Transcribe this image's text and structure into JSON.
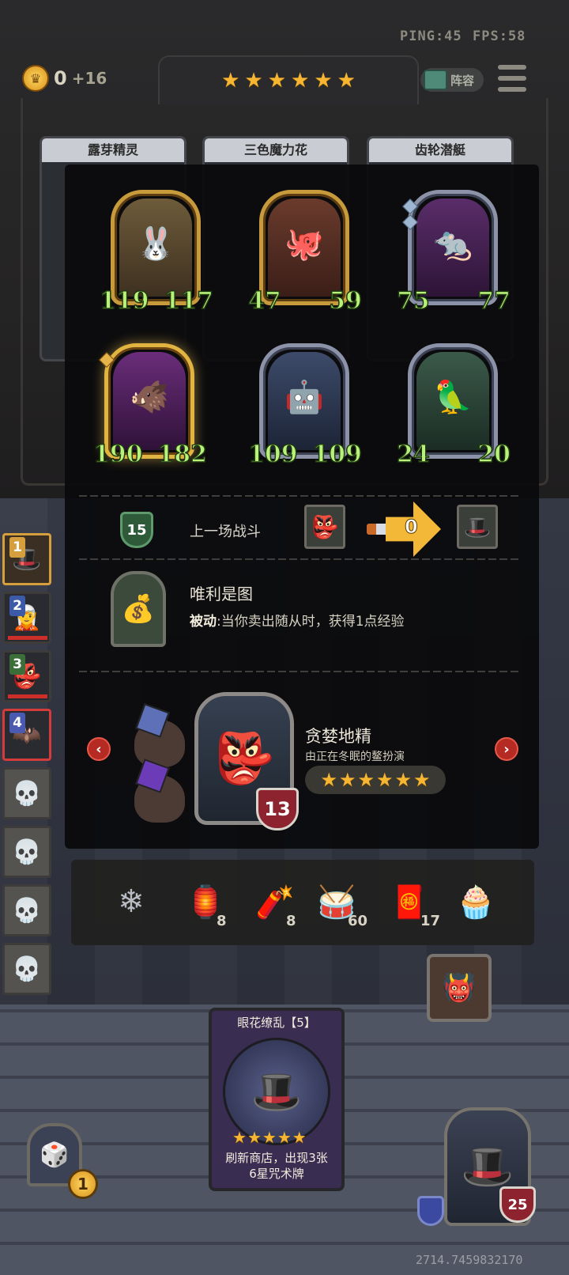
{
  "hud": {
    "ping_text": "PING:45",
    "fps_text": "FPS:58",
    "gold": "0",
    "gold_income": "+16",
    "tavern_stars": 6,
    "lineup_label": "阵容"
  },
  "shop": {
    "cards": [
      {
        "title": "露芽精灵"
      },
      {
        "title": "三色魔力花"
      },
      {
        "title": "齿轮潜艇"
      }
    ]
  },
  "opponent_board": {
    "minions": [
      {
        "attack": "119",
        "health": "117",
        "icon": "rabbit-icon"
      },
      {
        "attack": "47",
        "health": "59",
        "icon": "octopus-icon"
      },
      {
        "attack": "75",
        "health": "77",
        "icon": "rat-icon"
      },
      {
        "attack": "190",
        "health": "182",
        "icon": "boar-icon"
      },
      {
        "attack": "109",
        "health": "109",
        "icon": "mech-icon"
      },
      {
        "attack": "24",
        "health": "20",
        "icon": "parrot-icon"
      }
    ]
  },
  "last_battle": {
    "tier": "15",
    "label": "上一场战斗",
    "damage": "0"
  },
  "hero_power": {
    "name": "唯利是图",
    "desc_prefix": "被动",
    "desc_text": ":当你卖出随从时，获得1点经验"
  },
  "hero": {
    "name": "贪婪地精",
    "subtitle": "由正在冬眠的鳌扮演",
    "stars": 6,
    "armor": "13"
  },
  "consumables": [
    {
      "icon": "snowflake-icon",
      "count": ""
    },
    {
      "icon": "lantern-icon",
      "count": "8"
    },
    {
      "icon": "firecracker-icon",
      "count": "8"
    },
    {
      "icon": "drum-icon",
      "count": "60"
    },
    {
      "icon": "fortune-bag-icon",
      "count": "17"
    },
    {
      "icon": "cupcake-icon",
      "count": ""
    }
  ],
  "players": [
    {
      "rank": "1"
    },
    {
      "rank": "2"
    },
    {
      "rank": "3"
    },
    {
      "rank": "4"
    }
  ],
  "spell_card": {
    "title": "眼花缭乱【5】",
    "stars": 5,
    "line1": "刷新商店，出现3张",
    "line2": "6星咒术牌"
  },
  "reroll": {
    "cost": "1"
  },
  "player": {
    "armor": "25"
  },
  "coords": "2714.7459832170"
}
